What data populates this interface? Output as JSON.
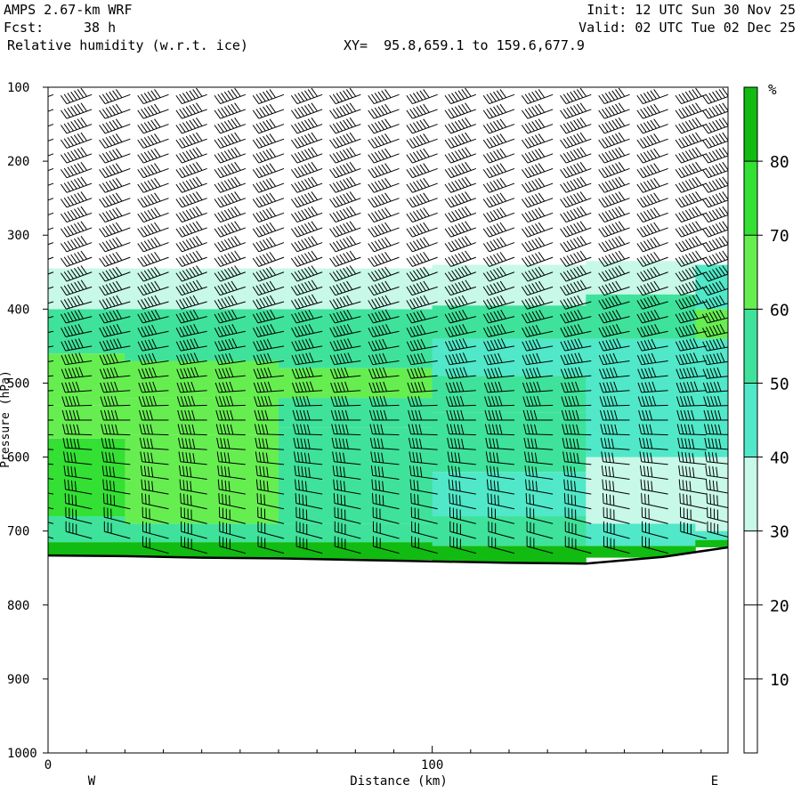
{
  "header": {
    "model": "AMPS 2.67-km WRF",
    "forecast_label": "Fcst:",
    "forecast_value": "38 h",
    "field": "Relative humidity (w.r.t. ice)",
    "xy": "XY=  95.8,659.1 to 159.6,677.9",
    "init": "Init: 12 UTC Sun 30 Nov 25",
    "valid": "Valid: 02 UTC Tue 02 Dec 25"
  },
  "chart_data": {
    "type": "heatmap",
    "title": "Relative humidity (w.r.t. ice)",
    "xlabel": "Distance (km)",
    "ylabel": "Pressure (hPa)",
    "xlim": [
      0,
      177
    ],
    "ylim": [
      1000,
      100
    ],
    "x_ticks": [
      0,
      100
    ],
    "y_ticks": [
      100,
      200,
      300,
      400,
      500,
      600,
      700,
      800,
      900,
      1000
    ],
    "left_end_label": "W",
    "right_end_label": "E",
    "colorbar": {
      "unit": "%",
      "levels": [
        0,
        10,
        20,
        30,
        40,
        50,
        60,
        70,
        80,
        90
      ],
      "tick_labels": [
        10,
        20,
        30,
        40,
        50,
        60,
        70,
        80
      ],
      "colors": [
        "#ffffff",
        "#ffffff",
        "#ffffff",
        "#c8f8e8",
        "#50e8c8",
        "#3fe29a",
        "#66ee50",
        "#33e033",
        "#11bb11"
      ]
    },
    "x_km": [
      0,
      20,
      40,
      60,
      80,
      100,
      120,
      140,
      160,
      177
    ],
    "surface_pressure_hpa": [
      733,
      734,
      736,
      737,
      739,
      741,
      743,
      744,
      735,
      722
    ],
    "rh_columns": [
      {
        "x": 0,
        "layers": [
          [
            740,
            715,
            85
          ],
          [
            715,
            680,
            58
          ],
          [
            680,
            575,
            72
          ],
          [
            575,
            530,
            62
          ],
          [
            530,
            460,
            60
          ],
          [
            460,
            400,
            55
          ],
          [
            400,
            345,
            35
          ]
        ]
      },
      {
        "x": 40,
        "layers": [
          [
            737,
            715,
            85
          ],
          [
            715,
            690,
            55
          ],
          [
            690,
            570,
            65
          ],
          [
            570,
            520,
            60
          ],
          [
            520,
            470,
            62
          ],
          [
            470,
            400,
            55
          ],
          [
            400,
            345,
            35
          ]
        ]
      },
      {
        "x": 80,
        "layers": [
          [
            739,
            715,
            85
          ],
          [
            715,
            690,
            55
          ],
          [
            690,
            560,
            58
          ],
          [
            560,
            520,
            55
          ],
          [
            520,
            480,
            62
          ],
          [
            480,
            400,
            55
          ],
          [
            400,
            345,
            35
          ]
        ]
      },
      {
        "x": 120,
        "layers": [
          [
            743,
            720,
            85
          ],
          [
            720,
            680,
            52
          ],
          [
            680,
            620,
            45
          ],
          [
            620,
            540,
            55
          ],
          [
            540,
            490,
            55
          ],
          [
            490,
            440,
            48
          ],
          [
            440,
            395,
            55
          ],
          [
            395,
            340,
            35
          ]
        ]
      },
      {
        "x": 160,
        "layers": [
          [
            736,
            720,
            85
          ],
          [
            720,
            690,
            45
          ],
          [
            690,
            600,
            35
          ],
          [
            600,
            440,
            45
          ],
          [
            440,
            380,
            55
          ],
          [
            380,
            335,
            35
          ]
        ]
      },
      {
        "x": 177,
        "layers": [
          [
            722,
            712,
            85
          ],
          [
            712,
            700,
            45
          ],
          [
            700,
            600,
            35
          ],
          [
            600,
            440,
            45
          ],
          [
            440,
            400,
            65
          ],
          [
            400,
            340,
            45
          ]
        ]
      }
    ],
    "wind_barbs": {
      "shown": true,
      "columns_x_km": [
        0,
        10,
        20,
        30,
        40,
        50,
        60,
        70,
        80,
        90,
        100,
        110,
        120,
        130,
        140,
        150,
        160,
        170,
        177
      ],
      "levels_spacing_hpa": 20,
      "upper_direction_deg": 250,
      "lower_direction_deg": 285,
      "speed_knots_range": [
        30,
        60
      ]
    },
    "grid": false
  }
}
